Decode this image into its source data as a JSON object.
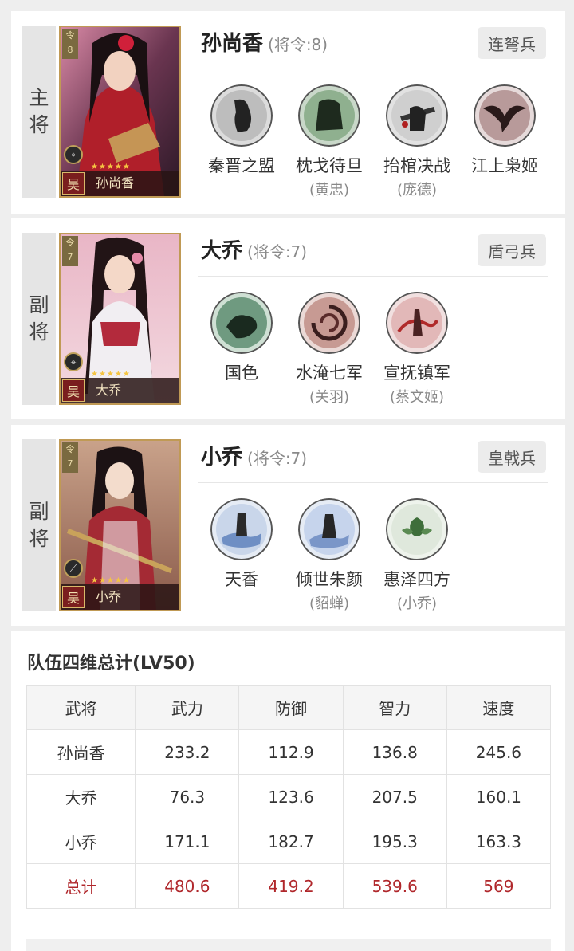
{
  "generals": [
    {
      "role": [
        "主",
        "将"
      ],
      "name": "孙尚香",
      "command": "(将令:8)",
      "command_badge": "8",
      "faction": "吴",
      "card_name": "孙尚香",
      "stars": "★★★★★",
      "troop": "连弩兵",
      "skills": [
        {
          "name": "秦晋之盟",
          "source": "",
          "icon": "silhouette-dance-icon",
          "tint": "#c9c9c9"
        },
        {
          "name": "枕戈待旦",
          "source": "(黄忠)",
          "icon": "armored-warrior-icon",
          "tint": "#8fb08f"
        },
        {
          "name": "抬棺决战",
          "source": "(庞德)",
          "icon": "coffin-battle-icon",
          "tint": "#d3d3d3"
        },
        {
          "name": "江上枭姬",
          "source": "",
          "icon": "phoenix-woman-icon",
          "tint": "#b89a9a"
        }
      ]
    },
    {
      "role": [
        "副",
        "将"
      ],
      "name": "大乔",
      "command": "(将令:7)",
      "command_badge": "7",
      "faction": "吴",
      "card_name": "大乔",
      "stars": "★★★★★",
      "troop": "盾弓兵",
      "skills": [
        {
          "name": "国色",
          "source": "",
          "icon": "beauty-ink-icon",
          "tint": "#6f9a80"
        },
        {
          "name": "水淹七军",
          "source": "(关羽)",
          "icon": "whirlpool-icon",
          "tint": "#c79a93"
        },
        {
          "name": "宣抚镇军",
          "source": "(蔡文姬)",
          "icon": "dancer-ribbon-icon",
          "tint": "#d8a8a8"
        }
      ]
    },
    {
      "role": [
        "副",
        "将"
      ],
      "name": "小乔",
      "command": "(将令:7)",
      "command_badge": "7",
      "faction": "吴",
      "card_name": "小乔",
      "stars": "★★★★★",
      "troop": "皇戟兵",
      "skills": [
        {
          "name": "天香",
          "source": "",
          "icon": "heavenly-fragrance-icon",
          "tint": "#9fb4d8"
        },
        {
          "name": "倾世朱颜",
          "source": "(貂蝉)",
          "icon": "peerless-beauty-icon",
          "tint": "#a6b8da"
        },
        {
          "name": "惠泽四方",
          "source": "(小乔)",
          "icon": "green-leaves-icon",
          "tint": "#8fb58a"
        }
      ]
    }
  ],
  "stats": {
    "title": "队伍四维总计(LV50)",
    "headers": [
      "武将",
      "武力",
      "防御",
      "智力",
      "速度"
    ],
    "rows": [
      [
        "孙尚香",
        "233.2",
        "112.9",
        "136.8",
        "245.6"
      ],
      [
        "大乔",
        "76.3",
        "123.6",
        "207.5",
        "160.1"
      ],
      [
        "小乔",
        "171.1",
        "182.7",
        "195.3",
        "163.3"
      ]
    ],
    "total": [
      "总计",
      "480.6",
      "419.2",
      "539.6",
      "569"
    ]
  },
  "colors": {
    "total_red": "#b0272b",
    "card_gold": "#c09a55",
    "role_bg": "#e5e5e5"
  }
}
